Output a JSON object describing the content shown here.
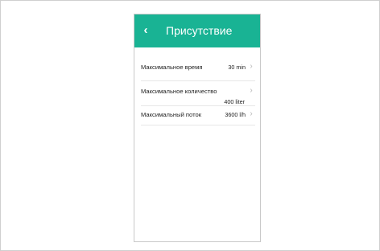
{
  "header": {
    "title": "Присутствие",
    "back_icon": "chevron-left-icon"
  },
  "settings": {
    "items": [
      {
        "label": "Максимальное время",
        "value": "30 min",
        "icon": "chevron-right-icon"
      },
      {
        "label": "Максимальное количество",
        "value": "400 liter",
        "icon": "chevron-right-icon"
      },
      {
        "label": "Максимальный поток",
        "value": "3600 l/h",
        "icon": "chevron-right-icon"
      }
    ]
  },
  "colors": {
    "accent": "#19b394",
    "text": "#1f1f1f",
    "divider": "#e7e7e7",
    "chevron": "#b6b6b6"
  }
}
